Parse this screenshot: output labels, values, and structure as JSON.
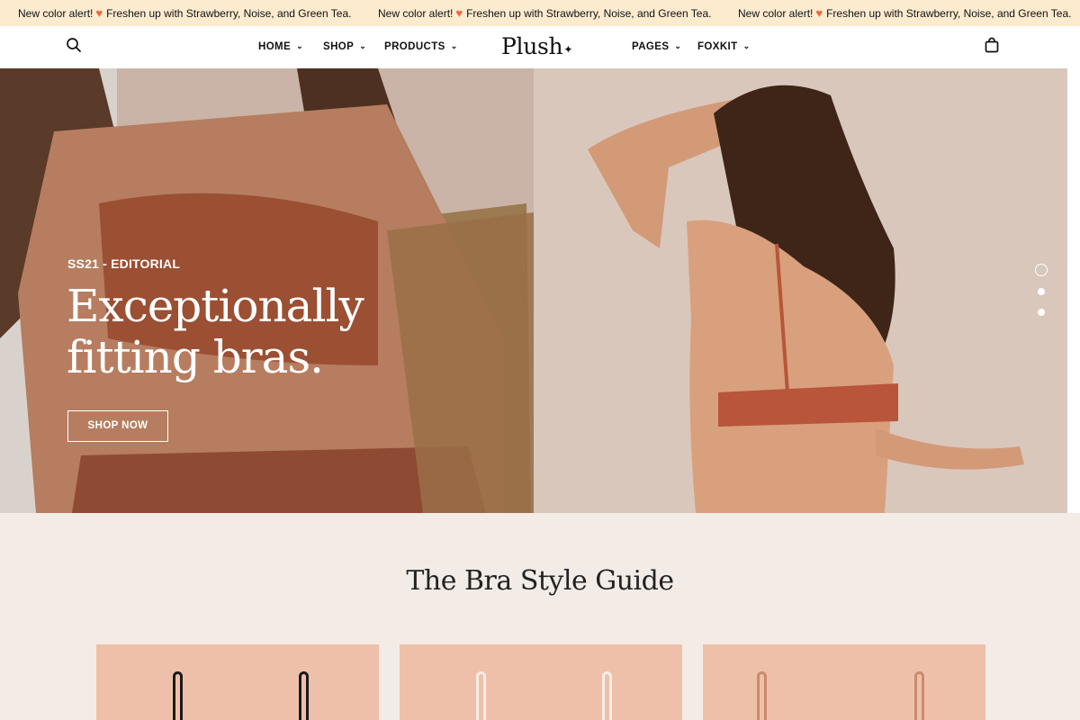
{
  "announcement": {
    "items": [
      {
        "lead": "New color alert!",
        "heart": "♥",
        "text": "Freshen up with Strawberry, Noise, and Green Tea."
      },
      {
        "lead": "New color alert!",
        "heart": "♥",
        "text": "Freshen up with Strawberry, Noise, and Green Tea."
      },
      {
        "lead": "New color alert!",
        "heart": "♥",
        "text": "Freshen up with Strawberry, Noise, and Green Tea."
      }
    ]
  },
  "header": {
    "logo": "Plush",
    "logo_mark": "✦",
    "nav": [
      {
        "label": "HOME"
      },
      {
        "label": "SHOP"
      },
      {
        "label": "PRODUCTS"
      },
      {
        "label": "PAGES"
      },
      {
        "label": "FOXKIT"
      }
    ],
    "chevron": "⌄"
  },
  "hero": {
    "eyebrow": "SS21 - EDITORIAL",
    "title": "Exceptionally fitting bras.",
    "cta": "SHOP NOW",
    "slide_count": 3,
    "active_slide": 1
  },
  "style_guide": {
    "title": "The Bra Style Guide",
    "cards": [
      {
        "strap_color": "#1a1a1a"
      },
      {
        "strap_color": "#f4ede6"
      },
      {
        "strap_color": "#c98a6e"
      }
    ]
  },
  "colors": {
    "announcement_bg": "#fcebcf",
    "section_bg": "#f3ece6",
    "card_bg": "#efc0a9",
    "heart": "#ee6a3a"
  }
}
